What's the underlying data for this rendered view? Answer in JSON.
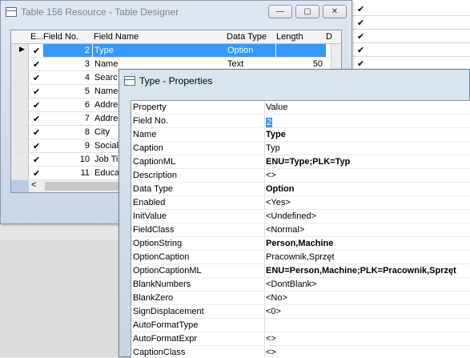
{
  "designer": {
    "title": "Table 156 Resource - Table Designer",
    "caption_buttons": [
      "—",
      "▢",
      "✕"
    ],
    "columns": [
      "E...",
      "Field No.",
      "Field Name",
      "Data Type",
      "Length",
      "D"
    ],
    "rows": [
      {
        "no": "2",
        "name": "Type",
        "type": "Option",
        "length": ""
      },
      {
        "no": "3",
        "name": "Name",
        "type": "Text",
        "length": "50"
      },
      {
        "no": "4",
        "name": "Searc",
        "type": "",
        "length": ""
      },
      {
        "no": "5",
        "name": "Name",
        "type": "",
        "length": ""
      },
      {
        "no": "6",
        "name": "Addre",
        "type": "",
        "length": ""
      },
      {
        "no": "7",
        "name": "Addre",
        "type": "",
        "length": ""
      },
      {
        "no": "8",
        "name": "City",
        "type": "",
        "length": ""
      },
      {
        "no": "9",
        "name": "Social",
        "type": "",
        "length": ""
      },
      {
        "no": "10",
        "name": "Job Ti",
        "type": "",
        "length": ""
      },
      {
        "no": "11",
        "name": "Educa",
        "type": "",
        "length": ""
      }
    ],
    "check_glyph": "✔",
    "scroll_left": "<",
    "scroll_up": "▲"
  },
  "properties": {
    "title": "Type - Properties",
    "header": {
      "property": "Property",
      "value": "Value"
    },
    "rows": [
      {
        "property": "Field No.",
        "value": "2",
        "bold": false,
        "cursor": true
      },
      {
        "property": "Name",
        "value": "Type",
        "bold": true
      },
      {
        "property": "Caption",
        "value": "Typ",
        "bold": false
      },
      {
        "property": "CaptionML",
        "value": "ENU=Type;PLK=Typ",
        "bold": true
      },
      {
        "property": "Description",
        "value": "<>",
        "bold": false
      },
      {
        "property": "Data Type",
        "value": "Option",
        "bold": true
      },
      {
        "property": "Enabled",
        "value": "<Yes>",
        "bold": false
      },
      {
        "property": "InitValue",
        "value": "<Undefined>",
        "bold": false
      },
      {
        "property": "FieldClass",
        "value": "<Normal>",
        "bold": false
      },
      {
        "property": "OptionString",
        "value": "Person,Machine",
        "bold": true
      },
      {
        "property": "OptionCaption",
        "value": "Pracownik,Sprzęt",
        "bold": false
      },
      {
        "property": "OptionCaptionML",
        "value": "ENU=Person,Machine;PLK=Pracownik,Sprzęt",
        "bold": true
      },
      {
        "property": "BlankNumbers",
        "value": "<DontBlank>",
        "bold": false
      },
      {
        "property": "BlankZero",
        "value": "<No>",
        "bold": false
      },
      {
        "property": "SignDisplacement",
        "value": "<0>",
        "bold": false
      },
      {
        "property": "AutoFormatType",
        "value": "",
        "bold": false
      },
      {
        "property": "AutoFormatExpr",
        "value": "<>",
        "bold": false
      },
      {
        "property": "CaptionClass",
        "value": "<>",
        "bold": false
      }
    ]
  },
  "colors": {
    "selection": "#3399ff",
    "window_border": "#8a9ab0"
  }
}
